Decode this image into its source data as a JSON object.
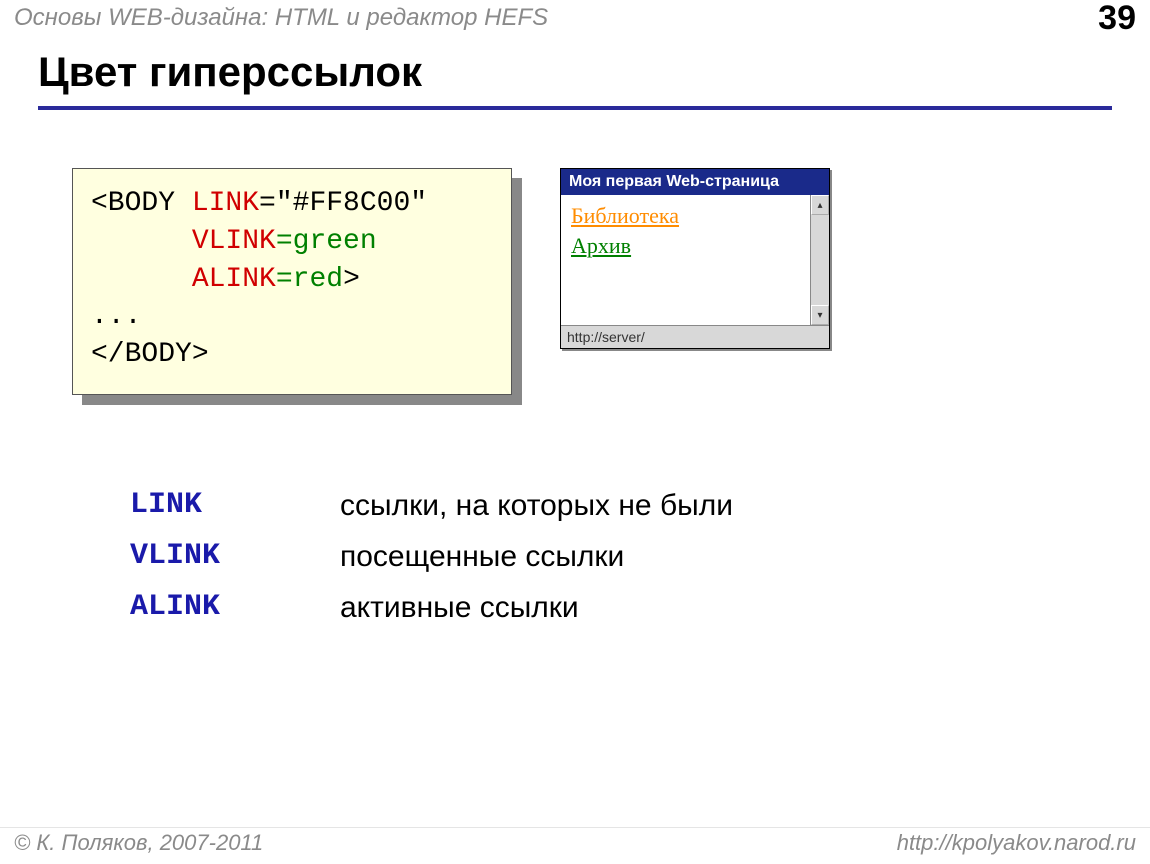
{
  "header": {
    "course_title": "Основы WEB-дизайна: HTML и редактор HEFS",
    "page_number": "39"
  },
  "title": "Цвет гиперссылок",
  "code": {
    "l1_open": "<BODY ",
    "l1_attr": "LINK",
    "l1_rest": "=\"#FF8C00\"",
    "l2_attr": "VLINK",
    "l2_rest": "=green ",
    "l3_attr": "ALINK",
    "l3_rest": "=red",
    "l3_close": ">",
    "dots": "...",
    "close": "</BODY>"
  },
  "browser": {
    "title": "Моя первая Web-страница",
    "link1": "Библиотека",
    "link2": "Архив",
    "status": "http://server/",
    "up": "▴",
    "down": "▾"
  },
  "defs": [
    {
      "term": "LINK",
      "desc": "ссылки, на которых не были"
    },
    {
      "term": "VLINK",
      "desc": "посещенные ссылки"
    },
    {
      "term": "ALINK",
      "desc": "активные ссылки"
    }
  ],
  "footer": {
    "copyright": "© К. Поляков, 2007-2011",
    "url": "http://kpolyakov.narod.ru"
  }
}
